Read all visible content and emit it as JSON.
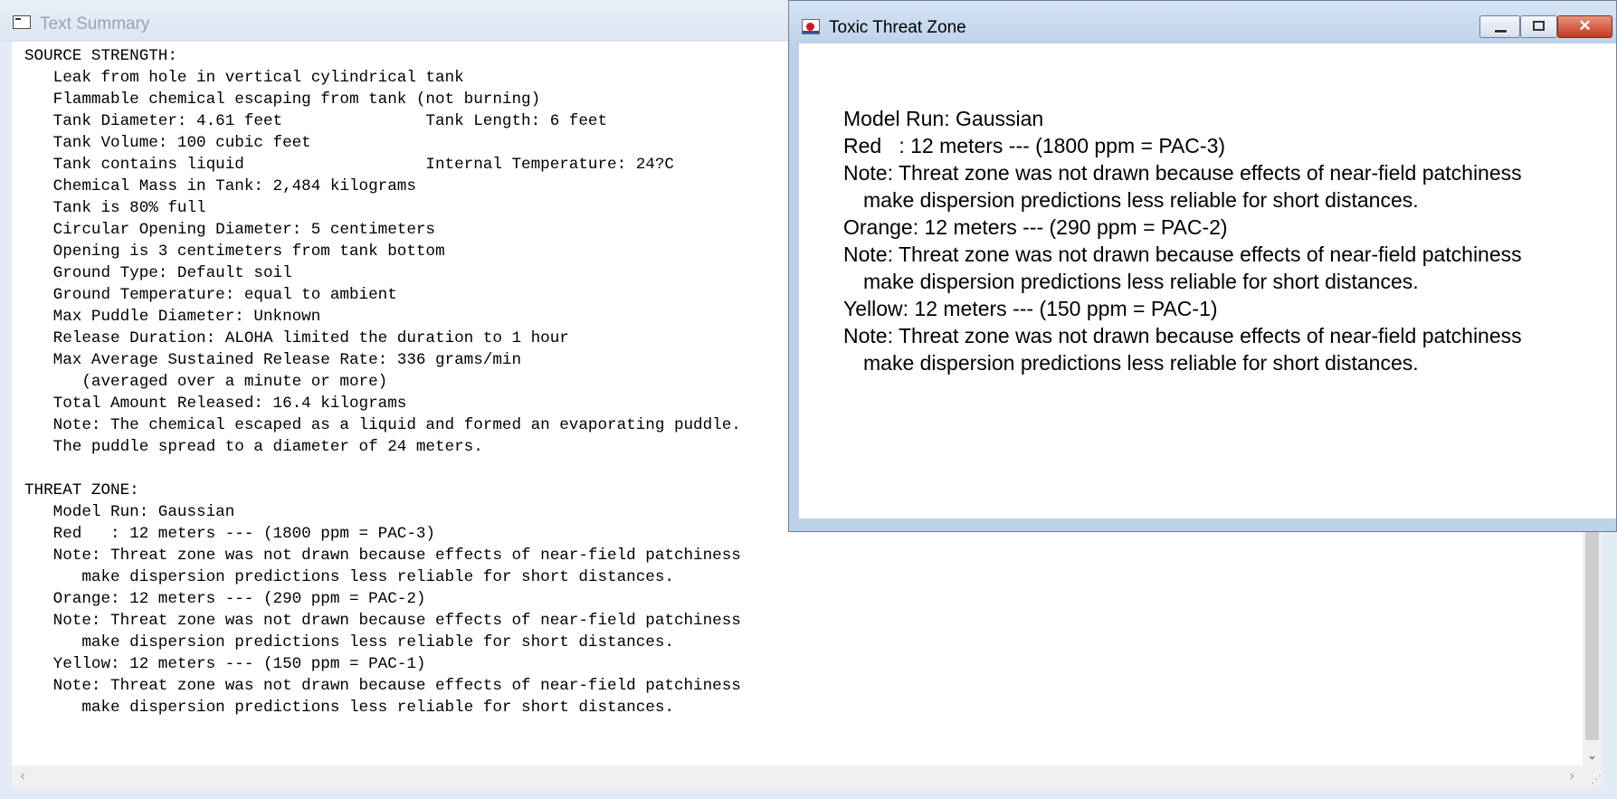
{
  "summary_window": {
    "title": "Text Summary",
    "lines": [
      "SOURCE STRENGTH:",
      "   Leak from hole in vertical cylindrical tank",
      "   Flammable chemical escaping from tank (not burning)",
      "   Tank Diameter: 4.61 feet               Tank Length: 6 feet",
      "   Tank Volume: 100 cubic feet",
      "   Tank contains liquid                   Internal Temperature: 24?C",
      "   Chemical Mass in Tank: 2,484 kilograms",
      "   Tank is 80% full",
      "   Circular Opening Diameter: 5 centimeters",
      "   Opening is 3 centimeters from tank bottom",
      "   Ground Type: Default soil",
      "   Ground Temperature: equal to ambient",
      "   Max Puddle Diameter: Unknown",
      "   Release Duration: ALOHA limited the duration to 1 hour",
      "   Max Average Sustained Release Rate: 336 grams/min",
      "      (averaged over a minute or more)",
      "   Total Amount Released: 16.4 kilograms",
      "   Note: The chemical escaped as a liquid and formed an evaporating puddle.",
      "   The puddle spread to a diameter of 24 meters.",
      "",
      "THREAT ZONE:",
      "   Model Run: Gaussian",
      "   Red   : 12 meters --- (1800 ppm = PAC-3)",
      "   Note: Threat zone was not drawn because effects of near-field patchiness",
      "      make dispersion predictions less reliable for short distances.",
      "   Orange: 12 meters --- (290 ppm = PAC-2)",
      "   Note: Threat zone was not drawn because effects of near-field patchiness",
      "      make dispersion predictions less reliable for short distances.",
      "   Yellow: 12 meters --- (150 ppm = PAC-1)",
      "   Note: Threat zone was not drawn because effects of near-field patchiness",
      "      make dispersion predictions less reliable for short distances."
    ]
  },
  "threat_window": {
    "title": "Toxic Threat Zone",
    "buttons": {
      "close": "✕"
    },
    "lines": [
      {
        "text": "Model Run: Gaussian",
        "indent": false
      },
      {
        "text": "Red   : 12 meters --- (1800 ppm = PAC-3)",
        "indent": false
      },
      {
        "text": "Note: Threat zone was not drawn because effects of near-field patchiness",
        "indent": false
      },
      {
        "text": "make dispersion predictions less reliable for short distances.",
        "indent": true
      },
      {
        "text": "Orange: 12 meters --- (290 ppm = PAC-2)",
        "indent": false
      },
      {
        "text": "Note: Threat zone was not drawn because effects of near-field patchiness",
        "indent": false
      },
      {
        "text": "make dispersion predictions less reliable for short distances.",
        "indent": true
      },
      {
        "text": "Yellow: 12 meters --- (150 ppm = PAC-1)",
        "indent": false
      },
      {
        "text": "Note: Threat zone was not drawn because effects of near-field patchiness",
        "indent": false
      },
      {
        "text": "make dispersion predictions less reliable for short distances.",
        "indent": true
      }
    ]
  },
  "scrollbars": {
    "down_arrow": "⌄",
    "left_arrow": "‹",
    "right_arrow": "›",
    "grip": "⋰"
  }
}
